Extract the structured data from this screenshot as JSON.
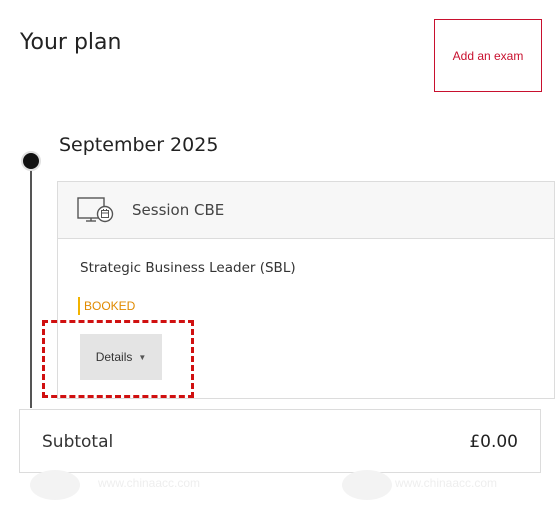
{
  "header": {
    "title": "Your plan",
    "add_exam_label": "Add an exam"
  },
  "timeline": {
    "month": "September 2025",
    "session": {
      "label": "Session CBE",
      "icon": "computer-exam-icon",
      "exam_name": "Strategic Business Leader (SBL)",
      "status": "BOOKED",
      "details_label": "Details"
    }
  },
  "summary": {
    "subtotal_label": "Subtotal",
    "subtotal_value": "£0.00"
  },
  "watermark": {
    "text": "www.chinaacc.com"
  },
  "colors": {
    "accent": "#c8102e",
    "status": "#e08a00",
    "highlight": "#d01010"
  }
}
